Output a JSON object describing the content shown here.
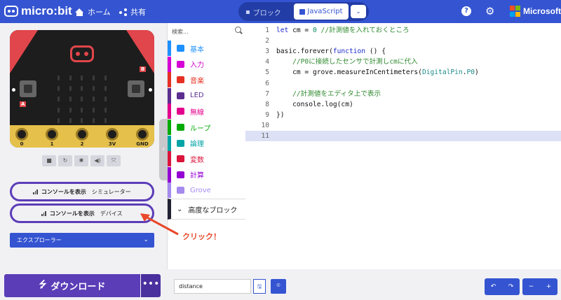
{
  "topbar": {
    "logo_text": "micro:bit",
    "home_label": "ホーム",
    "share_label": "共有",
    "blocks_label": "ブロック",
    "javascript_label": "JavaScript",
    "ms_label": "Microsoft",
    "help_glyph": "?",
    "gear_glyph": "⚙",
    "chevron_glyph": "⌄"
  },
  "simulator": {
    "pin_labels": [
      "0",
      "1",
      "2",
      "3V",
      "GND"
    ],
    "small_zero": "0",
    "button_a": "A",
    "button_b": "B",
    "tools": [
      "■",
      "↻",
      "✱",
      "◀)",
      "⤧"
    ],
    "console_sim": {
      "label": "コンソールを表示",
      "sub": "シミュレーター"
    },
    "console_dev": {
      "label": "コンソールを表示",
      "sub": "デバイス"
    },
    "explorer_label": "エクスプローラー",
    "download_label": "ダウンロード",
    "more_label": "•••",
    "collapse_glyph": "‹"
  },
  "toolbox": {
    "search_placeholder": "検索...",
    "categories": [
      {
        "label": "基本",
        "color": "#1e90ff"
      },
      {
        "label": "入力",
        "color": "#d400d4"
      },
      {
        "label": "音楽",
        "color": "#e63022"
      },
      {
        "label": "LED",
        "color": "#5c2d91"
      },
      {
        "label": "無線",
        "color": "#e3008c"
      },
      {
        "label": "ループ",
        "color": "#00aa00"
      },
      {
        "label": "論理",
        "color": "#00a4a6"
      },
      {
        "label": "変数",
        "color": "#dc143c"
      },
      {
        "label": "計算",
        "color": "#9400d3"
      },
      {
        "label": "Grove",
        "color": "#a58aef"
      }
    ],
    "advanced_label": "高度なブロック"
  },
  "editor": {
    "lines": [
      {
        "n": "1",
        "parts": [
          [
            "kw",
            "let"
          ],
          [
            "t",
            " cm = "
          ],
          [
            "num",
            "0"
          ],
          [
            "t",
            " "
          ],
          [
            "cm",
            "//計測値を入れておくところ"
          ]
        ]
      },
      {
        "n": "2",
        "parts": []
      },
      {
        "n": "3",
        "parts": [
          [
            "t",
            "basic.forever("
          ],
          [
            "kw",
            "function"
          ],
          [
            "t",
            " () {"
          ]
        ]
      },
      {
        "n": "4",
        "parts": [
          [
            "t",
            "    "
          ],
          [
            "cm",
            "//P0に接続したセンサで計測しcmに代入"
          ]
        ]
      },
      {
        "n": "5",
        "parts": [
          [
            "t",
            "    cm = grove.measureInCentimeters("
          ],
          [
            "tp",
            "DigitalPin"
          ],
          [
            "t",
            "."
          ],
          [
            "tp",
            "P0"
          ],
          [
            "t",
            ")"
          ]
        ]
      },
      {
        "n": "6",
        "parts": []
      },
      {
        "n": "7",
        "parts": [
          [
            "t",
            "    "
          ],
          [
            "cm",
            "//計測値をエディタ上で表示"
          ]
        ]
      },
      {
        "n": "8",
        "parts": [
          [
            "t",
            "    console.log(cm)"
          ]
        ]
      },
      {
        "n": "9",
        "parts": [
          [
            "t",
            "})"
          ]
        ]
      },
      {
        "n": "10",
        "parts": []
      },
      {
        "n": "11",
        "parts": []
      }
    ],
    "active_line": 11
  },
  "bottombar": {
    "project_name": "distance",
    "save_glyph": "🖫",
    "github_glyph": "⌾",
    "undo_glyph": "↶",
    "redo_glyph": "↷",
    "zoom_out_glyph": "−",
    "zoom_in_glyph": "+"
  },
  "annotation": {
    "text": "クリック！"
  },
  "colors": {
    "accent": "#3454d1",
    "purple": "#5b3db8",
    "annotation": "#e8482b"
  }
}
